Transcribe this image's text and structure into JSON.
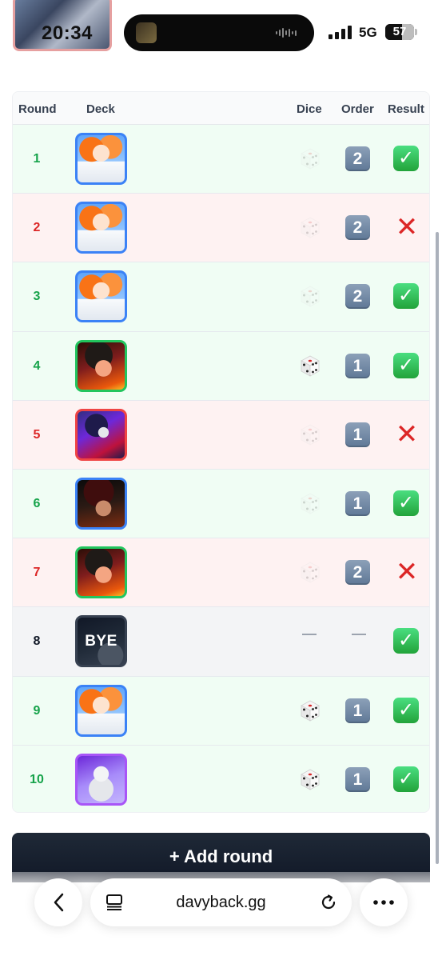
{
  "status_bar": {
    "time": "20:34",
    "network": "5G",
    "battery": "57",
    "battery_level": 0.57
  },
  "table": {
    "headers": {
      "round": "Round",
      "deck": "Deck",
      "dice": "Dice",
      "order": "Order",
      "result": "Result"
    },
    "rows": [
      {
        "round": "1",
        "deck": "nami",
        "dice": "faded",
        "order": "2",
        "result": "win"
      },
      {
        "round": "2",
        "deck": "nami",
        "dice": "faded",
        "order": "2",
        "result": "loss"
      },
      {
        "round": "3",
        "deck": "nami",
        "dice": "faded",
        "order": "2",
        "result": "win"
      },
      {
        "round": "4",
        "deck": "ace",
        "dice": "won",
        "order": "1",
        "result": "win"
      },
      {
        "round": "5",
        "deck": "lucci",
        "dice": "faded",
        "order": "1",
        "result": "loss"
      },
      {
        "round": "6",
        "deck": "shanks",
        "dice": "faded",
        "order": "1",
        "result": "win"
      },
      {
        "round": "7",
        "deck": "ace",
        "dice": "faded",
        "order": "2",
        "result": "loss"
      },
      {
        "round": "8",
        "deck": "bye",
        "deck_label": "BYE",
        "dice": "none",
        "order": "",
        "result": "win"
      },
      {
        "round": "9",
        "deck": "nami",
        "dice": "won",
        "order": "1",
        "result": "win"
      },
      {
        "round": "10",
        "deck": "ener",
        "dice": "won",
        "order": "1",
        "result": "win"
      }
    ]
  },
  "add_round": {
    "label": "+ Add round"
  },
  "browser": {
    "url": "davyback.gg"
  },
  "colors": {
    "win_bg": "#f0fdf4",
    "loss_bg": "#fef2f2",
    "bye_bg": "#f3f4f6",
    "win_text": "#16a34a",
    "loss_text": "#dc2626",
    "button_bg": "#111827"
  }
}
